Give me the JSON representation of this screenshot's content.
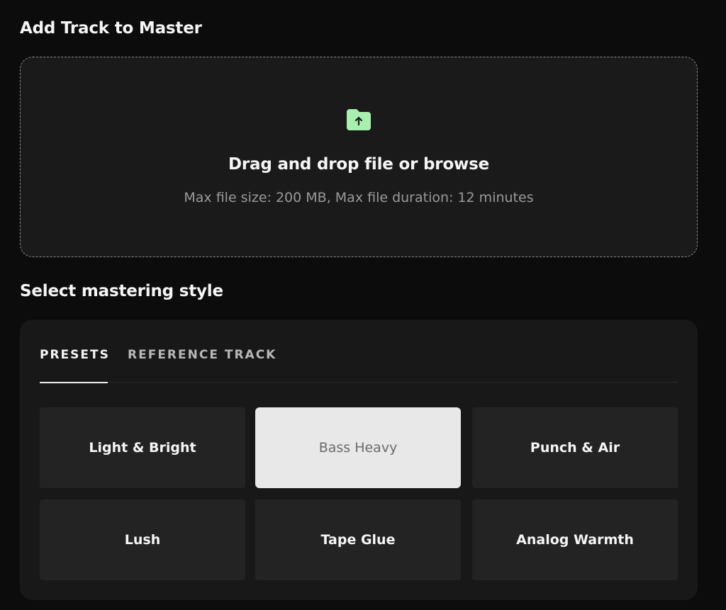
{
  "upload": {
    "section_title": "Add Track to Master",
    "drop_prefix": "Drag and drop file or ",
    "browse_label": "browse",
    "limits_text": "Max file size: 200 MB, Max file duration: 12 minutes",
    "icon": "folder-upload-icon",
    "icon_color": "#a8f0b0"
  },
  "style": {
    "section_title": "Select mastering style",
    "tabs": [
      {
        "label": "PRESETS",
        "active": true
      },
      {
        "label": "REFERENCE TRACK",
        "active": false
      }
    ],
    "presets": [
      {
        "label": "Light & Bright",
        "selected": false
      },
      {
        "label": "Bass Heavy",
        "selected": true
      },
      {
        "label": "Punch & Air",
        "selected": false
      },
      {
        "label": "Lush",
        "selected": false
      },
      {
        "label": "Tape Glue",
        "selected": false
      },
      {
        "label": "Analog Warmth",
        "selected": false
      }
    ]
  },
  "colors": {
    "background": "#0c0c0c",
    "panel": "#181818",
    "preset_card": "#232323",
    "selected_card": "#e8e8e8",
    "accent_green": "#a8f0b0"
  }
}
